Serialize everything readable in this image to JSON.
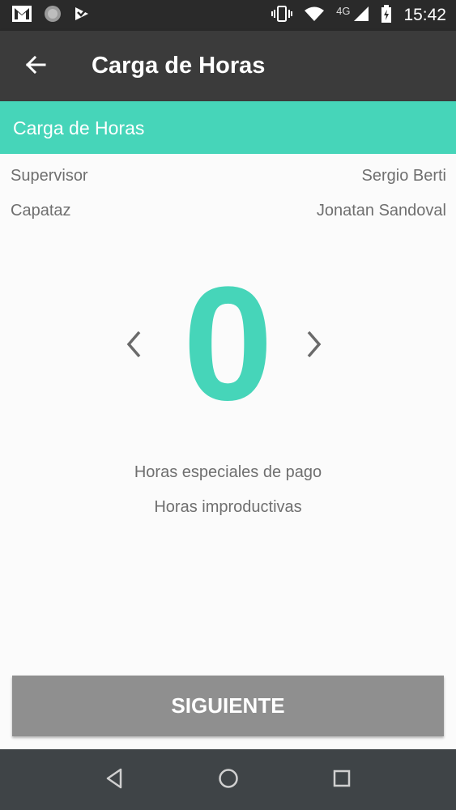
{
  "status_bar": {
    "time": "15:42",
    "network": "4G",
    "left_icons": [
      "gmail-icon",
      "circle-notification-icon",
      "play-store-icon"
    ],
    "right_icons": [
      "vibrate-icon",
      "wifi-icon",
      "signal-icon",
      "battery-charging-icon"
    ]
  },
  "app_bar": {
    "title": "Carga de Horas",
    "back_icon": "arrow-back-icon"
  },
  "section": {
    "title": "Carga de Horas"
  },
  "info": [
    {
      "label": "Supervisor",
      "value": "Sergio Berti"
    },
    {
      "label": "Capataz",
      "value": "Jonatan Sandoval"
    }
  ],
  "counter": {
    "value": "0",
    "color": "#46d5b9"
  },
  "options": [
    "Horas especiales de pago",
    "Horas improductivas"
  ],
  "next_button": {
    "label": "SIGUIENTE"
  },
  "colors": {
    "accent": "#46d5b9",
    "app_bar": "#3b3b3b",
    "button_disabled": "#8f8f8f"
  }
}
